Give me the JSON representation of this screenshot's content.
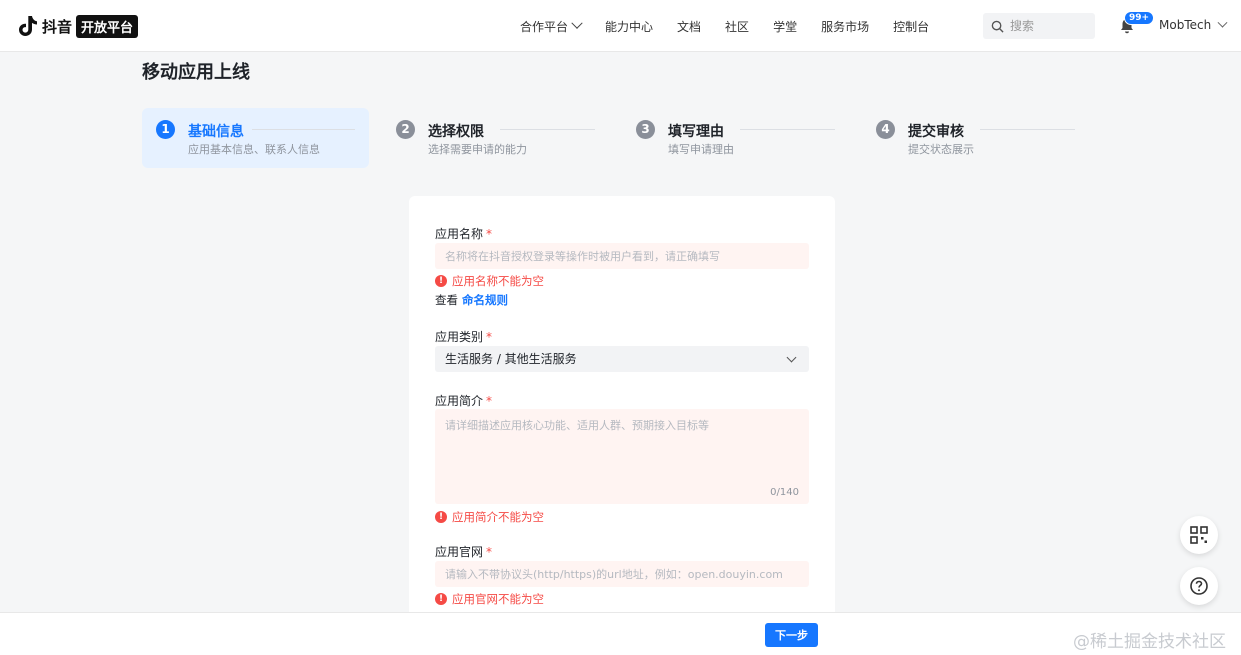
{
  "header": {
    "logo_text": "抖音",
    "logo_badge": "开放平台",
    "nav": [
      {
        "label": "合作平台",
        "has_dropdown": true
      },
      {
        "label": "能力中心"
      },
      {
        "label": "文档"
      },
      {
        "label": "社区"
      },
      {
        "label": "学堂"
      },
      {
        "label": "服务市场"
      },
      {
        "label": "控制台"
      }
    ],
    "search_placeholder": "搜索",
    "notification_badge": "99+",
    "user_name": "MobTech"
  },
  "page": {
    "title": "移动应用上线"
  },
  "steps": [
    {
      "num": "1",
      "title": "基础信息",
      "sub": "应用基本信息、联系人信息",
      "active": true
    },
    {
      "num": "2",
      "title": "选择权限",
      "sub": "选择需要申请的能力",
      "active": false
    },
    {
      "num": "3",
      "title": "填写理由",
      "sub": "填写申请理由",
      "active": false
    },
    {
      "num": "4",
      "title": "提交审核",
      "sub": "提交状态展示",
      "active": false
    }
  ],
  "form": {
    "app_name": {
      "label": "应用名称",
      "required_mark": "*",
      "placeholder": "名称将在抖音授权登录等操作时被用户看到，请正确填写",
      "error": "应用名称不能为空",
      "rule_prefix": "查看",
      "rule_link": "命名规则"
    },
    "app_category": {
      "label": "应用类别",
      "required_mark": "*",
      "value": "生活服务 / 其他生活服务"
    },
    "app_intro": {
      "label": "应用简介",
      "required_mark": "*",
      "placeholder": "请详细描述应用核心功能、适用人群、预期接入目标等",
      "counter": "0/140",
      "error": "应用简介不能为空"
    },
    "app_website": {
      "label": "应用官网",
      "required_mark": "*",
      "placeholder": "请输入不带协议头(http/https)的url地址，例如：open.douyin.com",
      "error": "应用官网不能为空"
    },
    "error_icon": "!"
  },
  "footer": {
    "next_label": "下一步",
    "watermark": "@稀土掘金技术社区"
  },
  "colors": {
    "primary": "#1677ff",
    "error": "#f54a45",
    "error_bg": "#fff4f2"
  }
}
